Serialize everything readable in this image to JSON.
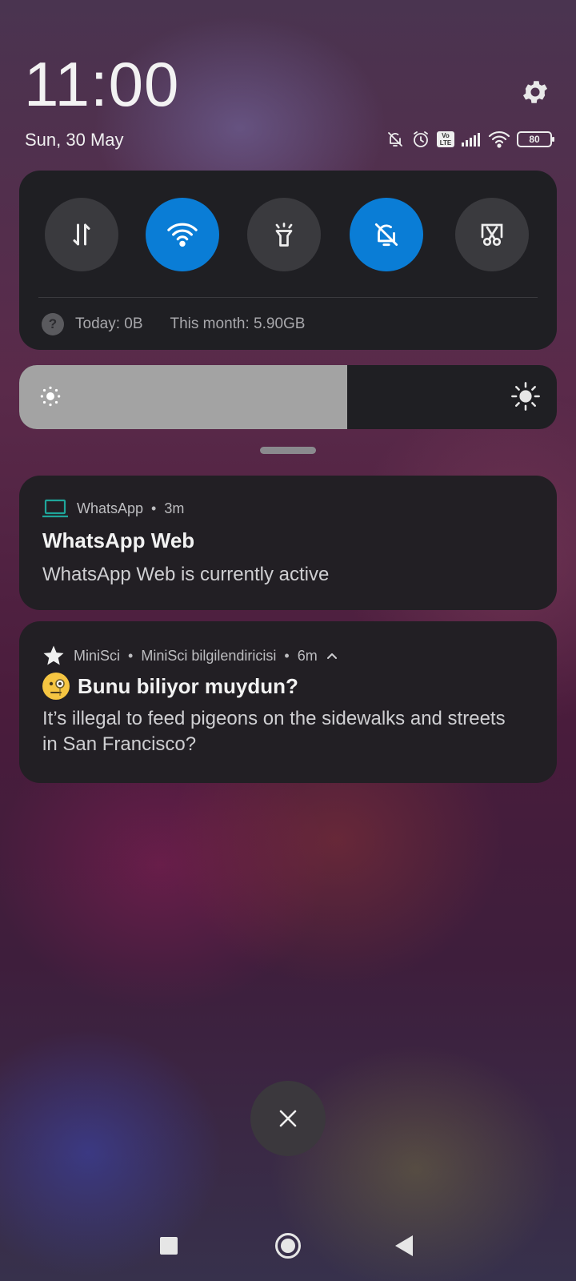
{
  "header": {
    "time": "11:00",
    "date": "Sun, 30 May",
    "battery": "80",
    "volte": "Vo LTE"
  },
  "quick_settings": {
    "tiles": [
      {
        "name": "mobile-data",
        "icon": "data-arrows-icon",
        "active": false
      },
      {
        "name": "wifi",
        "icon": "wifi-icon",
        "active": true
      },
      {
        "name": "flashlight",
        "icon": "flashlight-icon",
        "active": false
      },
      {
        "name": "mute",
        "icon": "bell-off-icon",
        "active": true
      },
      {
        "name": "screenshot",
        "icon": "scissors-icon",
        "active": false
      }
    ],
    "usage_icon": "?",
    "today": "Today: 0B",
    "this_month": "This month: 5.90GB",
    "active_color": "#0a7dd6"
  },
  "brightness": {
    "level_percent": 61
  },
  "notifications": [
    {
      "app": "WhatsApp",
      "time": "3m",
      "title": "WhatsApp Web",
      "body": "WhatsApp Web is currently active",
      "icon": "laptop-icon",
      "icon_color": "#1fa59a"
    },
    {
      "app": "MiniSci",
      "channel": "MiniSci bilgilendiricisi",
      "time": "6m",
      "title": "Bunu biliyor muydun?",
      "body": "It’s illegal to feed pigeons on the sidewalks and streets in San Francisco?",
      "icon": "star-icon",
      "emoji": "face-with-monocle-icon"
    }
  ]
}
